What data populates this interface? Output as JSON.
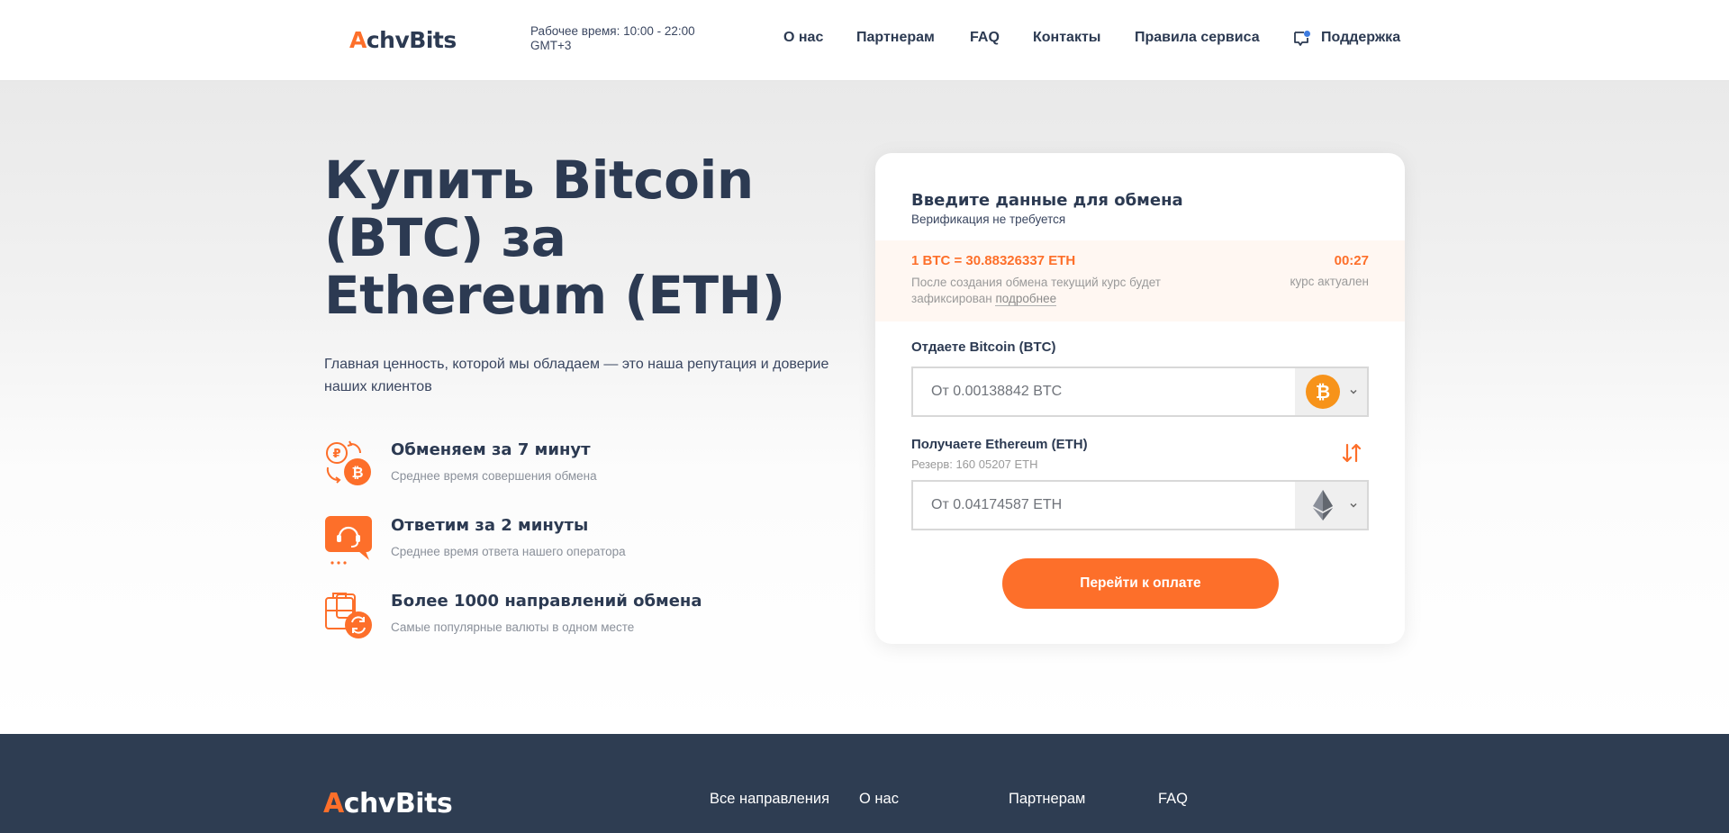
{
  "header": {
    "logo_first": "A",
    "logo_rest": "chvBits",
    "work_hours": "Рабочее время: 10:00 - 22:00 GMT+3",
    "nav": [
      "О нас",
      "Партнерам",
      "FAQ",
      "Контакты",
      "Правила сервиса",
      "Поддержка"
    ]
  },
  "hero": {
    "title": "Купить Bitcoin (BTC) за Ethereum (ETH)",
    "subtitle": "Главная ценность, которой мы обладаем — это наша репутация и доверие наших клиентов",
    "features": [
      {
        "title": "Обменяем за 7 минут",
        "desc": "Среднее время совершения обмена",
        "icon": "exchange-clock-icon"
      },
      {
        "title": "Ответим за 2 минуты",
        "desc": "Среднее время ответа нашего оператора",
        "icon": "support-chat-icon"
      },
      {
        "title": "Более 1000 направлений обмена",
        "desc": "Самые популярные валюты в одном месте",
        "icon": "directions-icon"
      }
    ]
  },
  "exchange": {
    "title": "Введите данные для обмена",
    "subtitle": "Верификация не требуется",
    "rate": "1 BTC = 30.88326337 ETH",
    "rate_note": "После создания обмена текущий курс будет зафиксирован",
    "rate_link": "подробнее",
    "timer": "00:27",
    "timer_note": "курс актуален",
    "give_label": "Отдаете Bitcoin (BTC)",
    "give_placeholder": "От 0.00138842 BTC",
    "receive_label": "Получаете Ethereum (ETH)",
    "reserve": "Резерв: 160 05207 ETH",
    "receive_placeholder": "От 0.04174587 ETH",
    "pay_button": "Перейти к оплате"
  },
  "footer": {
    "logo_first": "A",
    "logo_rest": "chvBits",
    "links": [
      "Все направления",
      "О нас",
      "Партнерам",
      "FAQ"
    ]
  },
  "colors": {
    "accent": "#fd6f2a",
    "text": "#2c3a52",
    "footer_bg": "#2e3d52"
  }
}
